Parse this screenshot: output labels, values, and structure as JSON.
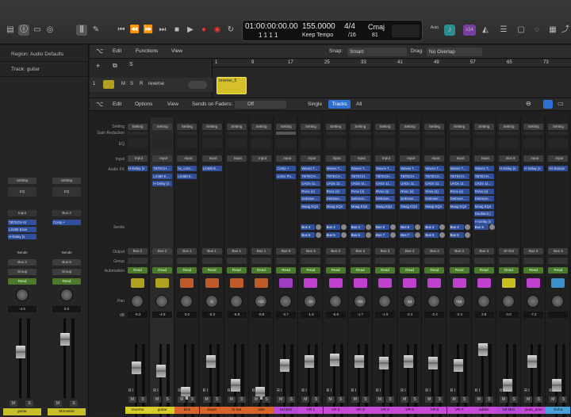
{
  "toolbar": {
    "lcd": {
      "position": "01:00:00:00.00",
      "bars": "1  1  1     1",
      "tempo": "155.0000",
      "tempo_mode": "Keep Tempo",
      "sig": "4/4",
      "sig_div": "/16",
      "key": "Cmaj",
      "val81": "81",
      "x34": "x34",
      "auto_label": "Auto"
    }
  },
  "inspector": {
    "region": "Region: Audio Defaults",
    "track": "Track: guitar"
  },
  "tracks_area": {
    "menu_edit": "Edit",
    "menu_functions": "Functions",
    "menu_view": "View",
    "snap_label": "Snap:",
    "snap_value": "Smart",
    "drag_label": "Drag:",
    "drag_value": "No Overlap",
    "ruler": [
      "1",
      "9",
      "17",
      "25",
      "33",
      "41",
      "49",
      "57",
      "65",
      "73"
    ],
    "track_num": "1",
    "track_name": "reverse",
    "region_name": "reverse_5",
    "m": "M",
    "s": "S",
    "r": "R"
  },
  "mixer": {
    "menu_edit": "Edit",
    "menu_options": "Options",
    "menu_view": "View",
    "sends_on_faders": "Sends on Faders:",
    "sends_value": "Off",
    "single": "Single",
    "tracks": "Tracks",
    "all": "All",
    "row_labels": {
      "setting": "Setting",
      "gain": "Gain Reduction",
      "eq": "EQ",
      "input": "Input",
      "audiofx": "Audio FX",
      "sends": "Sends",
      "output": "Output",
      "group": "Group",
      "automation": "Automation",
      "pan": "Pan",
      "db": "dB"
    }
  },
  "inspector_strips": [
    {
      "setting": "Setting",
      "eq": "EQ",
      "input": "Input",
      "plugins": [
        "TBTECH Kr",
        "LX480 Esse",
        "H-Delay (s"
      ],
      "sends": "Sends",
      "output": "Bus 2",
      "group": "Group",
      "auto": "Read",
      "db": "-4.5",
      "name": "guitar",
      "m": "M",
      "s": "S",
      "r": "R",
      "i": "I"
    },
    {
      "setting": "Setting",
      "eq": "EQ",
      "input": "Bus 2",
      "plugins": [
        "Comp +"
      ],
      "sends": "Sends",
      "output": "Bus 9",
      "group": "Group",
      "auto": "Read",
      "db": "0.0",
      "name": "MonoDel",
      "m": "M",
      "s": "S",
      "r": "R",
      "i": "I"
    }
  ],
  "strips": [
    {
      "name": "reverse",
      "color": "#d8cc2a",
      "output": "Bus 2",
      "input": "Input",
      "plugins": [
        "H-Delay (s"
      ],
      "sends": [],
      "pan": "",
      "db": "-9.2",
      "icon": "#b0a020",
      "auto": "Read"
    },
    {
      "name": "guitar",
      "color": "#d8cc2a",
      "output": "Bus 2",
      "input": "Input",
      "plugins": [
        "TBTECH...",
        "LX480 E...",
        "H-Delay (s"
      ],
      "sends": [],
      "pan": "",
      "db": "-4.5",
      "icon": "#b0a020",
      "auto": "Read"
    },
    {
      "name": "kick",
      "color": "#d8642a",
      "output": "Bus 1",
      "input": "Input",
      "plugins": [
        "bx_cons...",
        "LX480 E..."
      ],
      "sends": [],
      "pan": "",
      "db": "0.0",
      "icon": "#c05a28",
      "auto": "Read"
    },
    {
      "name": "snare",
      "color": "#d8642a",
      "output": "Bus 1",
      "input": "Input",
      "plugins": [
        "LX480 E..."
      ],
      "sends": [],
      "pan": "-2",
      "db": "-5.3",
      "icon": "#c05a28",
      "auto": "Read"
    },
    {
      "name": "hi hat",
      "color": "#d8642a",
      "output": "Bus 1",
      "input": "Input",
      "plugins": [],
      "sends": [],
      "pan": "",
      "db": "-6.8",
      "icon": "#c05a28",
      "auto": "Read"
    },
    {
      "name": "vide",
      "color": "#d8642a",
      "output": "Bus 1",
      "input": "Input",
      "plugins": [],
      "sends": [],
      "pan": "+10",
      "db": "-8.8",
      "icon": "#c05a28",
      "auto": "Read"
    },
    {
      "name": "Uit BIG",
      "color": "#b84ad8",
      "output": "Bus 6",
      "input": "Input",
      "plugins": [
        "Comp +",
        "UADx Pu..."
      ],
      "sends": [],
      "pan": "",
      "db": "0.7",
      "icon": "#a03cc0",
      "auto": "Read"
    },
    {
      "name": "VR 1",
      "color": "#c84ad8",
      "output": "Bus 3",
      "input": "Input",
      "plugins": [
        "Waves T...",
        "TBTECH...",
        "UADx 11...",
        "RVox (s)",
        "DeEsser...",
        "Maag EQ4"
      ],
      "sends": [
        "Bus 4",
        "Bus 5"
      ],
      "pan": "-10",
      "db": "-1.6",
      "icon": "#c040d0",
      "auto": "Read"
    },
    {
      "name": "VR 2",
      "color": "#c84ad8",
      "output": "Bus 3",
      "input": "Input",
      "plugins": [
        "Waves T...",
        "TBTECH...",
        "UADx 11...",
        "RVox (s)",
        "DeEsser...",
        "Maag EQ4"
      ],
      "sends": [
        "Bus 4",
        "Bus 5"
      ],
      "pan": "",
      "db": "-5.8",
      "icon": "#c040d0",
      "auto": "Read"
    },
    {
      "name": "VR 3",
      "color": "#c84ad8",
      "output": "Bus 3",
      "input": "Input",
      "plugins": [
        "Waves T...",
        "TBTECH...",
        "UADx 11...",
        "RVox (s)",
        "DeEsser...",
        "Maag EQ4"
      ],
      "sends": [
        "Bus 4",
        "Bus 5"
      ],
      "pan": "+10",
      "db": "-1.7",
      "icon": "#c040d0",
      "auto": "Read"
    },
    {
      "name": "VR 4",
      "color": "#c84ad8",
      "output": "Bus 3",
      "input": "Input",
      "plugins": [
        "Waves T...",
        "TBTECH...",
        "UADx 11...",
        "RVox (s)",
        "DeEsser...",
        "Maag EQ4"
      ],
      "sends": [
        "Bus 6",
        "Bus 7"
      ],
      "pan": "",
      "db": "-1.9",
      "icon": "#c040d0",
      "auto": "Read"
    },
    {
      "name": "VR 5",
      "color": "#c84ad8",
      "output": "Bus 3",
      "input": "Input",
      "plugins": [
        "Waves T...",
        "TBTECH...",
        "UADx 11...",
        "RVox (s)",
        "DeEsser...",
        "Maag EQ4"
      ],
      "sends": [
        "Bus 6",
        "Bus 7"
      ],
      "pan": "-14",
      "db": "-2.4",
      "icon": "#c040d0",
      "auto": "Read"
    },
    {
      "name": "VR 6",
      "color": "#c84ad8",
      "output": "Bus 3",
      "input": "Input",
      "plugins": [
        "Waves T...",
        "TBTECH...",
        "UADx 11...",
        "RVox (s)",
        "DeEsser...",
        "Maag EQ4"
      ],
      "sends": [
        "Bus 4",
        "Bus 5"
      ],
      "pan": "",
      "db": "-2.4",
      "icon": "#c040d0",
      "auto": "Read"
    },
    {
      "name": "VR 7",
      "color": "#c84ad8",
      "output": "Bus 3",
      "input": "Input",
      "plugins": [
        "Waves T...",
        "TBTECH...",
        "UADx 11...",
        "RVox (s)",
        "DeEsser...",
        "Maag EQ4"
      ],
      "sends": [
        "Bus 4",
        "Bus 5"
      ],
      "pan": "+16",
      "db": "-2.4",
      "icon": "#c040d0",
      "auto": "Read"
    },
    {
      "name": "adlibs",
      "color": "#c84ad8",
      "output": "Bus 3",
      "input": "Input",
      "plugins": [
        "Waves T...",
        "TBTECH...",
        "UADx 11...",
        "RVox (s)",
        "DeEsser...",
        "Maag EQ4",
        "Doubler2 (",
        "H-Delay (s"
      ],
      "sends": [
        "Bus 9"
      ],
      "pan": "",
      "db": "3.8",
      "icon": "#c040d0",
      "auto": "Read"
    },
    {
      "name": "Uit BIG",
      "color": "#b84ad8",
      "output": "St Out",
      "input": "Bus 9",
      "plugins": [
        "H-Delay (s"
      ],
      "sends": [],
      "pan": "",
      "db": "0.0",
      "icon": "#c8c020",
      "auto": "Read"
    },
    {
      "name": "yeah_arse",
      "color": "#c84ad8",
      "output": "Bus 3",
      "input": "Input",
      "plugins": [
        "H-Delay (s"
      ],
      "sends": [],
      "pan": "",
      "db": "-7.2",
      "icon": "#c040d0",
      "auto": "Read"
    },
    {
      "name": "Exha",
      "color": "#4aa0d8",
      "output": "Bus 3",
      "input": "Input",
      "plugins": [
        "Hs Brainw"
      ],
      "sends": [],
      "pan": "",
      "db": "",
      "icon": "#3a90c8",
      "auto": "Read"
    }
  ]
}
